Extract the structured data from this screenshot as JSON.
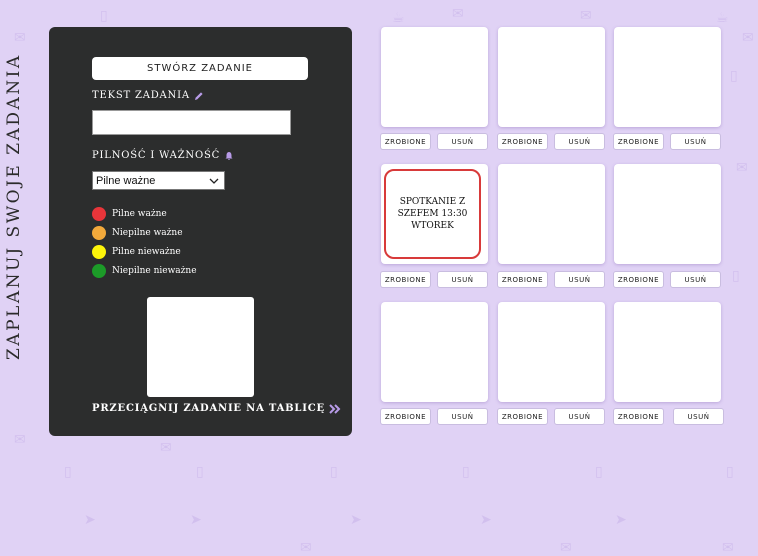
{
  "page": {
    "vertical_title": "ZAPLANUJ SWOJE ZADANIA"
  },
  "panel": {
    "create_button": "STWÓRZ ZADANIE",
    "task_text_label": "TEKST ZADANIA",
    "task_text_value": "",
    "priority_label": "PILNOŚĆ I WAŻNOŚĆ",
    "priority_selected": "Pilne ważne",
    "legend": [
      {
        "label": "Pilne ważne",
        "color": "#e8353a"
      },
      {
        "label": "Niepilne ważne",
        "color": "#f2a93b"
      },
      {
        "label": "Pilne nieważne",
        "color": "#fdf40a"
      },
      {
        "label": "Niepilne nieważne",
        "color": "#1c9b28"
      }
    ],
    "drag_label": "PRZECIĄGNIJ ZADANIE NA TABLICĘ"
  },
  "board": {
    "done_label": "ZROBIONE",
    "delete_label": "USUŃ",
    "cards": [
      {
        "text": ""
      },
      {
        "text": ""
      },
      {
        "text": ""
      },
      {
        "text": "SPOTKANIE Z SZEFEM 13:30 WTOREK",
        "priority_color": "#d83a3a"
      },
      {
        "text": ""
      },
      {
        "text": ""
      },
      {
        "text": ""
      },
      {
        "text": ""
      },
      {
        "text": ""
      }
    ]
  },
  "icons": {
    "pencil": "pencil-icon",
    "bell": "bell-icon",
    "chevron": "chevron-down-icon",
    "double_arrow": "double-chevron-right-icon"
  },
  "colors": {
    "background": "#e0d2f5",
    "panel": "#2c2d2d",
    "accent": "#b89be8"
  }
}
